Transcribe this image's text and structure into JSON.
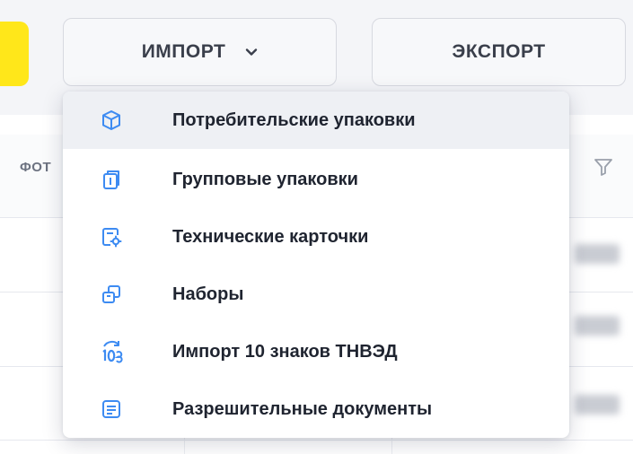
{
  "toolbar": {
    "import_label": "ИМПОРТ",
    "export_label": "ЭКСПОРТ"
  },
  "table": {
    "header_partial_label": "ФОТ"
  },
  "import_menu": {
    "items": [
      {
        "label": "Потребительские упаковки",
        "icon": "cube-icon"
      },
      {
        "label": "Групповые упаковки",
        "icon": "group-pack-icon"
      },
      {
        "label": "Технические карточки",
        "icon": "tech-card-icon"
      },
      {
        "label": "Наборы",
        "icon": "sets-icon"
      },
      {
        "label": "Импорт 10 знаков ТНВЭД",
        "icon": "tnved-10-icon"
      },
      {
        "label": "Разрешительные документы",
        "icon": "document-icon"
      }
    ]
  },
  "colors": {
    "accent_yellow": "#ffe71a",
    "icon_blue": "#3d8bf2",
    "menu_active_bg": "#eef0f4"
  }
}
